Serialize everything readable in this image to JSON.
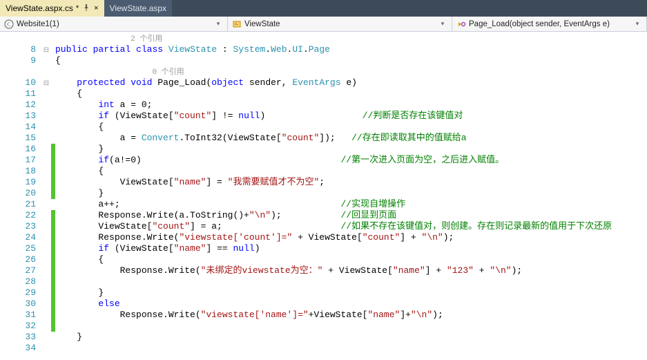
{
  "tabs": [
    {
      "label": "ViewState.aspx.cs",
      "active": true,
      "unsaved": "*",
      "icon": "pin"
    },
    {
      "label": "ViewState.aspx",
      "active": false
    }
  ],
  "nav": {
    "project": "Website1(1)",
    "type_icon": "class-icon",
    "type": "ViewState",
    "member_icon": "method-icon",
    "member": "Page_Load(object sender, EventArgs e)"
  },
  "codelens": {
    "ref2": "2 个引用",
    "ref0": "0 个引用"
  },
  "lines": [
    {
      "n": "",
      "marker": "",
      "change": "",
      "tokens": [
        [
          "plain",
          "              "
        ],
        [
          "codelens",
          "2 个引用"
        ]
      ]
    },
    {
      "n": "8",
      "marker": "box",
      "change": "",
      "tokens": [
        [
          "kw",
          "public"
        ],
        [
          "plain",
          " "
        ],
        [
          "kw",
          "partial"
        ],
        [
          "plain",
          " "
        ],
        [
          "kw",
          "class"
        ],
        [
          "plain",
          " "
        ],
        [
          "type",
          "ViewState"
        ],
        [
          "plain",
          " : "
        ],
        [
          "type",
          "System"
        ],
        [
          "plain",
          "."
        ],
        [
          "type",
          "Web"
        ],
        [
          "plain",
          "."
        ],
        [
          "type",
          "UI"
        ],
        [
          "plain",
          "."
        ],
        [
          "type",
          "Page"
        ]
      ]
    },
    {
      "n": "9",
      "marker": "",
      "change": "",
      "tokens": [
        [
          "plain",
          "{"
        ]
      ]
    },
    {
      "n": "",
      "marker": "",
      "change": "",
      "tokens": [
        [
          "plain",
          "                  "
        ],
        [
          "codelens",
          "0 个引用"
        ]
      ]
    },
    {
      "n": "10",
      "marker": "box",
      "change": "",
      "tokens": [
        [
          "plain",
          "    "
        ],
        [
          "kw",
          "protected"
        ],
        [
          "plain",
          " "
        ],
        [
          "kw",
          "void"
        ],
        [
          "plain",
          " Page_Load("
        ],
        [
          "kw",
          "object"
        ],
        [
          "plain",
          " sender, "
        ],
        [
          "type",
          "EventArgs"
        ],
        [
          "plain",
          " e)"
        ]
      ]
    },
    {
      "n": "11",
      "marker": "",
      "change": "",
      "tokens": [
        [
          "plain",
          "    {"
        ]
      ]
    },
    {
      "n": "12",
      "marker": "",
      "change": "",
      "tokens": [
        [
          "plain",
          "        "
        ],
        [
          "kw",
          "int"
        ],
        [
          "plain",
          " a = 0;"
        ]
      ]
    },
    {
      "n": "13",
      "marker": "",
      "change": "",
      "tokens": [
        [
          "plain",
          "        "
        ],
        [
          "kw",
          "if"
        ],
        [
          "plain",
          " (ViewState["
        ],
        [
          "str",
          "\"count\""
        ],
        [
          "plain",
          "] != "
        ],
        [
          "kw",
          "null"
        ],
        [
          "plain",
          ")                  "
        ],
        [
          "cm",
          "//判断是否存在该键值对"
        ]
      ]
    },
    {
      "n": "14",
      "marker": "",
      "change": "",
      "tokens": [
        [
          "plain",
          "        {"
        ]
      ]
    },
    {
      "n": "15",
      "marker": "",
      "change": "",
      "tokens": [
        [
          "plain",
          "            a = "
        ],
        [
          "type",
          "Convert"
        ],
        [
          "plain",
          ".ToInt32(ViewState["
        ],
        [
          "str",
          "\"count\""
        ],
        [
          "plain",
          "]);   "
        ],
        [
          "cm",
          "//存在即读取其中的值赋给a"
        ]
      ]
    },
    {
      "n": "16",
      "marker": "",
      "change": "g",
      "tokens": [
        [
          "plain",
          "        }"
        ]
      ]
    },
    {
      "n": "17",
      "marker": "",
      "change": "g",
      "tokens": [
        [
          "plain",
          "        "
        ],
        [
          "kw",
          "if"
        ],
        [
          "plain",
          "(a!=0)                                     "
        ],
        [
          "cm",
          "//第一次进入页面为空，之后进入赋值。"
        ]
      ]
    },
    {
      "n": "18",
      "marker": "",
      "change": "g",
      "tokens": [
        [
          "plain",
          "        {"
        ]
      ]
    },
    {
      "n": "19",
      "marker": "",
      "change": "g",
      "tokens": [
        [
          "plain",
          "            ViewState["
        ],
        [
          "str",
          "\"name\""
        ],
        [
          "plain",
          "] = "
        ],
        [
          "str",
          "\"我需要赋值才不为空\""
        ],
        [
          "plain",
          ";"
        ]
      ]
    },
    {
      "n": "20",
      "marker": "",
      "change": "g",
      "tokens": [
        [
          "plain",
          "        }"
        ]
      ]
    },
    {
      "n": "21",
      "marker": "",
      "change": "",
      "tokens": [
        [
          "plain",
          "        a++;                                         "
        ],
        [
          "cm",
          "//实现自增操作"
        ]
      ]
    },
    {
      "n": "22",
      "marker": "",
      "change": "g",
      "tokens": [
        [
          "plain",
          "        Response.Write(a.ToString()+"
        ],
        [
          "str",
          "\"\\n\""
        ],
        [
          "plain",
          ");           "
        ],
        [
          "cm",
          "//回显到页面"
        ]
      ]
    },
    {
      "n": "23",
      "marker": "",
      "change": "g",
      "tokens": [
        [
          "plain",
          "        ViewState["
        ],
        [
          "str",
          "\"count\""
        ],
        [
          "plain",
          "] = a;                      "
        ],
        [
          "cm",
          "//如果不存在该键值对，则创建。存在则记录最新的值用于下次还原"
        ]
      ]
    },
    {
      "n": "24",
      "marker": "",
      "change": "g",
      "tokens": [
        [
          "plain",
          "        Response.Write("
        ],
        [
          "str",
          "\"viewstate['count']=\""
        ],
        [
          "plain",
          " + ViewState["
        ],
        [
          "str",
          "\"count\""
        ],
        [
          "plain",
          "] + "
        ],
        [
          "str",
          "\"\\n\""
        ],
        [
          "plain",
          ");"
        ]
      ]
    },
    {
      "n": "25",
      "marker": "",
      "change": "g",
      "tokens": [
        [
          "plain",
          "        "
        ],
        [
          "kw",
          "if"
        ],
        [
          "plain",
          " (ViewState["
        ],
        [
          "str",
          "\"name\""
        ],
        [
          "plain",
          "] == "
        ],
        [
          "kw",
          "null"
        ],
        [
          "plain",
          ")"
        ]
      ]
    },
    {
      "n": "26",
      "marker": "",
      "change": "g",
      "tokens": [
        [
          "plain",
          "        {"
        ]
      ]
    },
    {
      "n": "27",
      "marker": "",
      "change": "g",
      "tokens": [
        [
          "plain",
          "            Response.Write("
        ],
        [
          "str",
          "\"未绑定的viewstate为空：\""
        ],
        [
          "plain",
          " + ViewState["
        ],
        [
          "str",
          "\"name\""
        ],
        [
          "plain",
          "] + "
        ],
        [
          "str",
          "\"123\""
        ],
        [
          "plain",
          " + "
        ],
        [
          "str",
          "\"\\n\""
        ],
        [
          "plain",
          ");"
        ]
      ]
    },
    {
      "n": "28",
      "marker": "",
      "change": "g",
      "tokens": [
        [
          "plain",
          ""
        ]
      ]
    },
    {
      "n": "29",
      "marker": "",
      "change": "g",
      "tokens": [
        [
          "plain",
          "        }"
        ]
      ]
    },
    {
      "n": "30",
      "marker": "",
      "change": "g",
      "tokens": [
        [
          "plain",
          "        "
        ],
        [
          "kw",
          "else"
        ]
      ]
    },
    {
      "n": "31",
      "marker": "",
      "change": "g",
      "tokens": [
        [
          "plain",
          "            Response.Write("
        ],
        [
          "str",
          "\"viewstate['name']=\""
        ],
        [
          "plain",
          "+ViewState["
        ],
        [
          "str",
          "\"name\""
        ],
        [
          "plain",
          "]+"
        ],
        [
          "str",
          "\"\\n\""
        ],
        [
          "plain",
          ");"
        ]
      ]
    },
    {
      "n": "32",
      "marker": "",
      "change": "g",
      "tokens": [
        [
          "plain",
          ""
        ]
      ]
    },
    {
      "n": "33",
      "marker": "",
      "change": "",
      "tokens": [
        [
          "plain",
          "    }"
        ]
      ]
    },
    {
      "n": "34",
      "marker": "",
      "change": "",
      "tokens": [
        [
          "plain",
          ""
        ]
      ]
    }
  ]
}
